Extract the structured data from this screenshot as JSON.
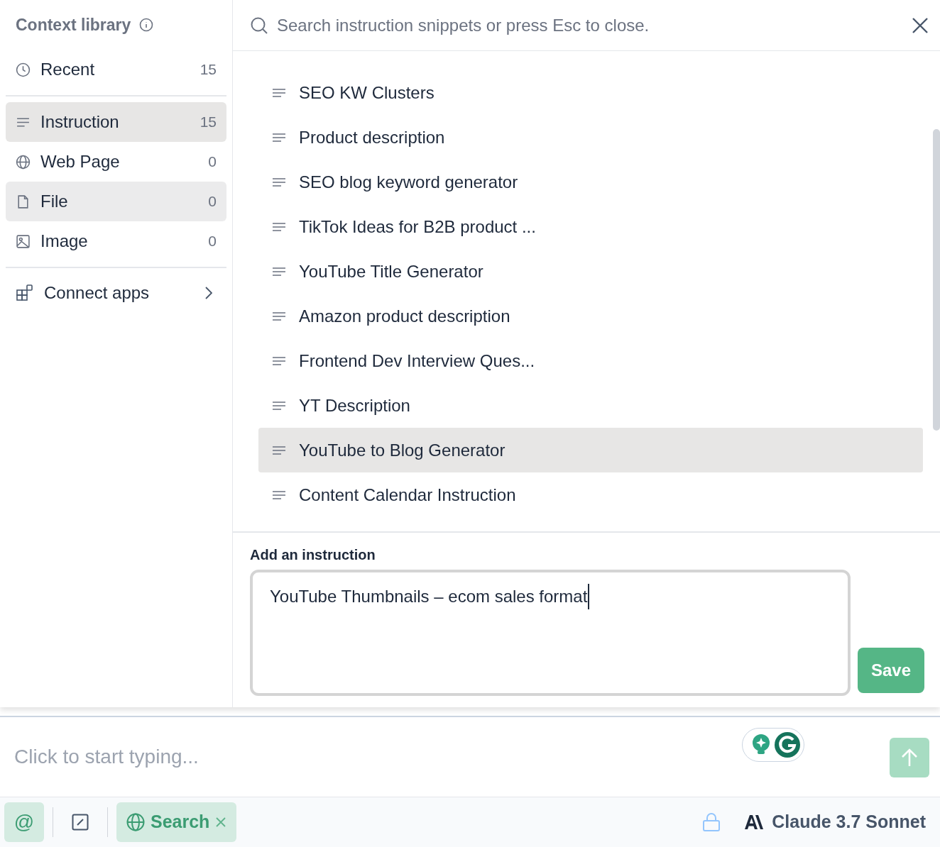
{
  "sidebar": {
    "title": "Context library",
    "items": [
      {
        "kind": "recent",
        "label": "Recent",
        "count": "15",
        "selected": false,
        "hovered": false
      },
      {
        "kind": "instruction",
        "label": "Instruction",
        "count": "15",
        "selected": true,
        "hovered": false
      },
      {
        "kind": "web",
        "label": "Web Page",
        "count": "0",
        "selected": false,
        "hovered": false
      },
      {
        "kind": "file",
        "label": "File",
        "count": "0",
        "selected": false,
        "hovered": true
      },
      {
        "kind": "image",
        "label": "Image",
        "count": "0",
        "selected": false,
        "hovered": false
      }
    ],
    "connect": {
      "label": "Connect apps"
    }
  },
  "search": {
    "placeholder": "Search instruction snippets or press Esc to close."
  },
  "snippets": [
    {
      "label": "SEO KW Clusters",
      "selected": false
    },
    {
      "label": "Product description",
      "selected": false
    },
    {
      "label": "SEO blog keyword generator",
      "selected": false
    },
    {
      "label": "TikTok Ideas for B2B product ...",
      "selected": false
    },
    {
      "label": "YouTube Title Generator",
      "selected": false
    },
    {
      "label": "Amazon product description",
      "selected": false
    },
    {
      "label": "Frontend Dev Interview Ques...",
      "selected": false
    },
    {
      "label": "YT Description",
      "selected": false
    },
    {
      "label": "YouTube to Blog Generator",
      "selected": true
    },
    {
      "label": "Content Calendar Instruction",
      "selected": false
    }
  ],
  "add_instruction": {
    "label": "Add an instruction",
    "value": "YouTube Thumbnails – ecom sales format",
    "button": "Save"
  },
  "composer": {
    "placeholder": "Click to start typing..."
  },
  "toolbar": {
    "mention": "@",
    "search_chip": "Search",
    "model": "Claude 3.7 Sonnet"
  }
}
